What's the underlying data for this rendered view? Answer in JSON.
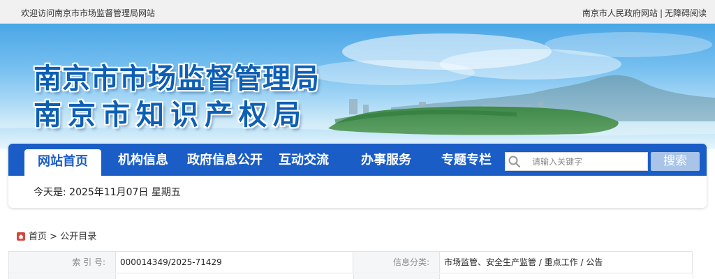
{
  "topbar": {
    "welcome": "欢迎访问南京市市场监督管理局网站",
    "gov_link": "南京市人民政府网站",
    "separator": "|",
    "accessibility_link": "无障碍阅读"
  },
  "banner": {
    "title_line1": "南京市市场监督管理局",
    "title_line2": "南京市知识产权局"
  },
  "nav": {
    "items": [
      {
        "label": "网站首页",
        "active": true
      },
      {
        "label": "机构信息"
      },
      {
        "label": "政府信息公开"
      },
      {
        "label": "互动交流"
      },
      {
        "label": "办事服务"
      },
      {
        "label": "专题专栏"
      }
    ]
  },
  "search": {
    "placeholder": "请输入关键字",
    "button": "搜索"
  },
  "date_text": "今天是: 2025年11月07日 星期五",
  "breadcrumb": {
    "home": "首页",
    "separator": ">",
    "current": "公开目录"
  },
  "info": {
    "index_label": "索 引 号:",
    "index_value": "000014349/2025-71429",
    "category_label": "信息分类:",
    "category_value": "市场监管、安全生产监管 / 重点工作 / 公告"
  },
  "colors": {
    "nav_blue": "#1a5dc6",
    "title_blue": "#0d5fb5",
    "search_button": "#a9c4e8"
  }
}
